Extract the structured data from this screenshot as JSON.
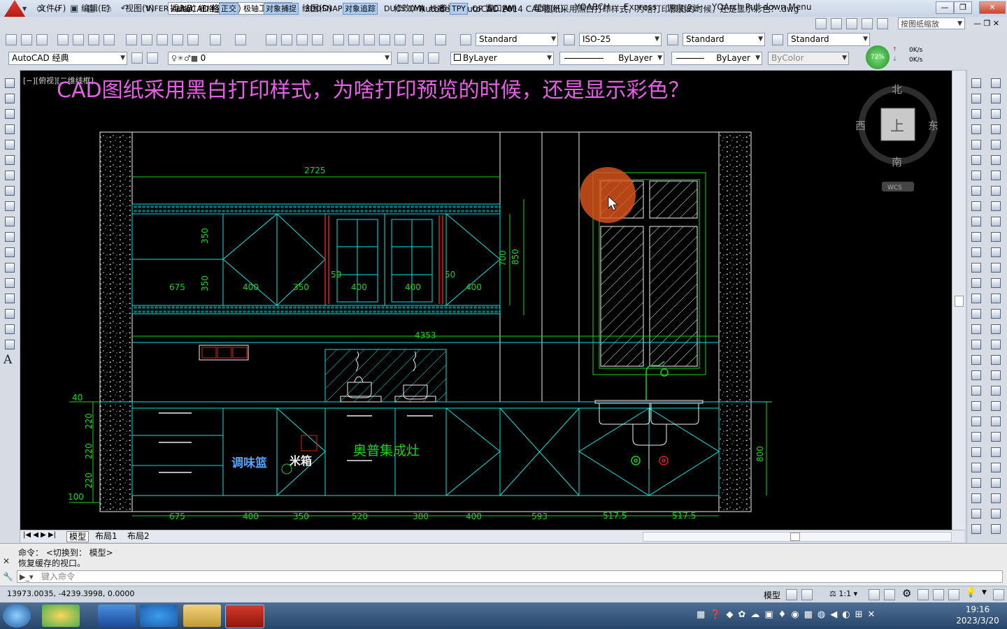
{
  "window": {
    "title": "Autodesk AutoCAD 2014    CAD图纸采用黑白打印样式，为啥打印预览的时候，还是显示彩色？.dwg",
    "workspace": "AutoCAD 经典",
    "btn_min": "—",
    "btn_restore": "❐",
    "btn_close": "✕"
  },
  "menubar": {
    "items": [
      "文件(F)",
      "编辑(E)",
      "视图(V)",
      "插入(I)",
      "格式(O)",
      "工具(T)",
      "绘图(D)",
      "标注(N)",
      "修改(M)",
      "参数(P)",
      "窗口(W)",
      "帮助(H)",
      "YQARCH",
      "Express",
      "源泉设计",
      "YQArch Pull-down Menu"
    ],
    "zoom_input": "按图纸缩放"
  },
  "styles_toolbar": {
    "text_style": "Standard",
    "dim_style": "ISO-25",
    "table_style": "Standard",
    "multileader_style": "Standard"
  },
  "layers_toolbar": {
    "workspace": "AutoCAD 经典",
    "layer": "0",
    "color": "ByLayer",
    "linetype": "ByLayer",
    "lineweight": "ByLayer",
    "plotstyle": "ByColor",
    "perf_percent": "72%",
    "net_up": "0K/s",
    "net_down": "0K/s"
  },
  "viewport": {
    "label": "[−][俯视][二维线框]",
    "heading": "CAD图纸采用黑白打印样式，为啥打印预览的时候，还是显示彩色？",
    "viewcube": {
      "north": "北",
      "south": "南",
      "east": "东",
      "west": "西",
      "top": "上",
      "wcs": "WCS"
    }
  },
  "drawing": {
    "dim_total_upper": "2725",
    "dim_total_mid": "4353",
    "upper_widths": [
      "675",
      "400",
      "350",
      "400",
      "400",
      "400"
    ],
    "upper_heights": [
      "350",
      "350"
    ],
    "upper_right": [
      "700",
      "850"
    ],
    "upper_gaps": [
      "50",
      "50"
    ],
    "left_heights": [
      "40",
      "220",
      "220",
      "220",
      "100"
    ],
    "lower_widths": [
      "675",
      "400",
      "350",
      "520",
      "380",
      "400",
      "593",
      "517.5",
      "517.5"
    ],
    "lower_right": "800",
    "label_spice": "调味篮",
    "label_rice": "米箱",
    "label_stove": "奥普集成灶"
  },
  "layout_tabs": [
    "模型",
    "布局1",
    "布局2"
  ],
  "command": {
    "line1": "命令：  <切换到： 模型>",
    "line2": "恢复缓存的视口。",
    "placeholder": "键入命令"
  },
  "statusbar": {
    "coords": "13973.0035, -4239.3998, 0.0000",
    "toggles": [
      {
        "label": "INFER",
        "on": false
      },
      {
        "label": "捕捉",
        "on": false
      },
      {
        "label": "栅格",
        "on": false
      },
      {
        "label": "正交",
        "on": true
      },
      {
        "label": "极轴",
        "on": false
      },
      {
        "label": "对象捕捉",
        "on": true
      },
      {
        "label": "3DOSNAP",
        "on": false
      },
      {
        "label": "对象追踪",
        "on": true
      },
      {
        "label": "DUCS",
        "on": false
      },
      {
        "label": "DYN",
        "on": false
      },
      {
        "label": "线宽",
        "on": false
      },
      {
        "label": "TPY",
        "on": true
      },
      {
        "label": "QP",
        "on": false
      },
      {
        "label": "SC",
        "on": false
      },
      {
        "label": "AM",
        "on": false
      }
    ],
    "model": "模型",
    "scale": "1:1"
  },
  "taskbar": {
    "time": "19:16",
    "date": "2023/3/20"
  },
  "colors": {
    "cyan": "#00e5e5",
    "green": "#19d219",
    "magenta": "#e65fe6",
    "red": "#e21b1b",
    "cursor_halo": "#e0561d"
  }
}
